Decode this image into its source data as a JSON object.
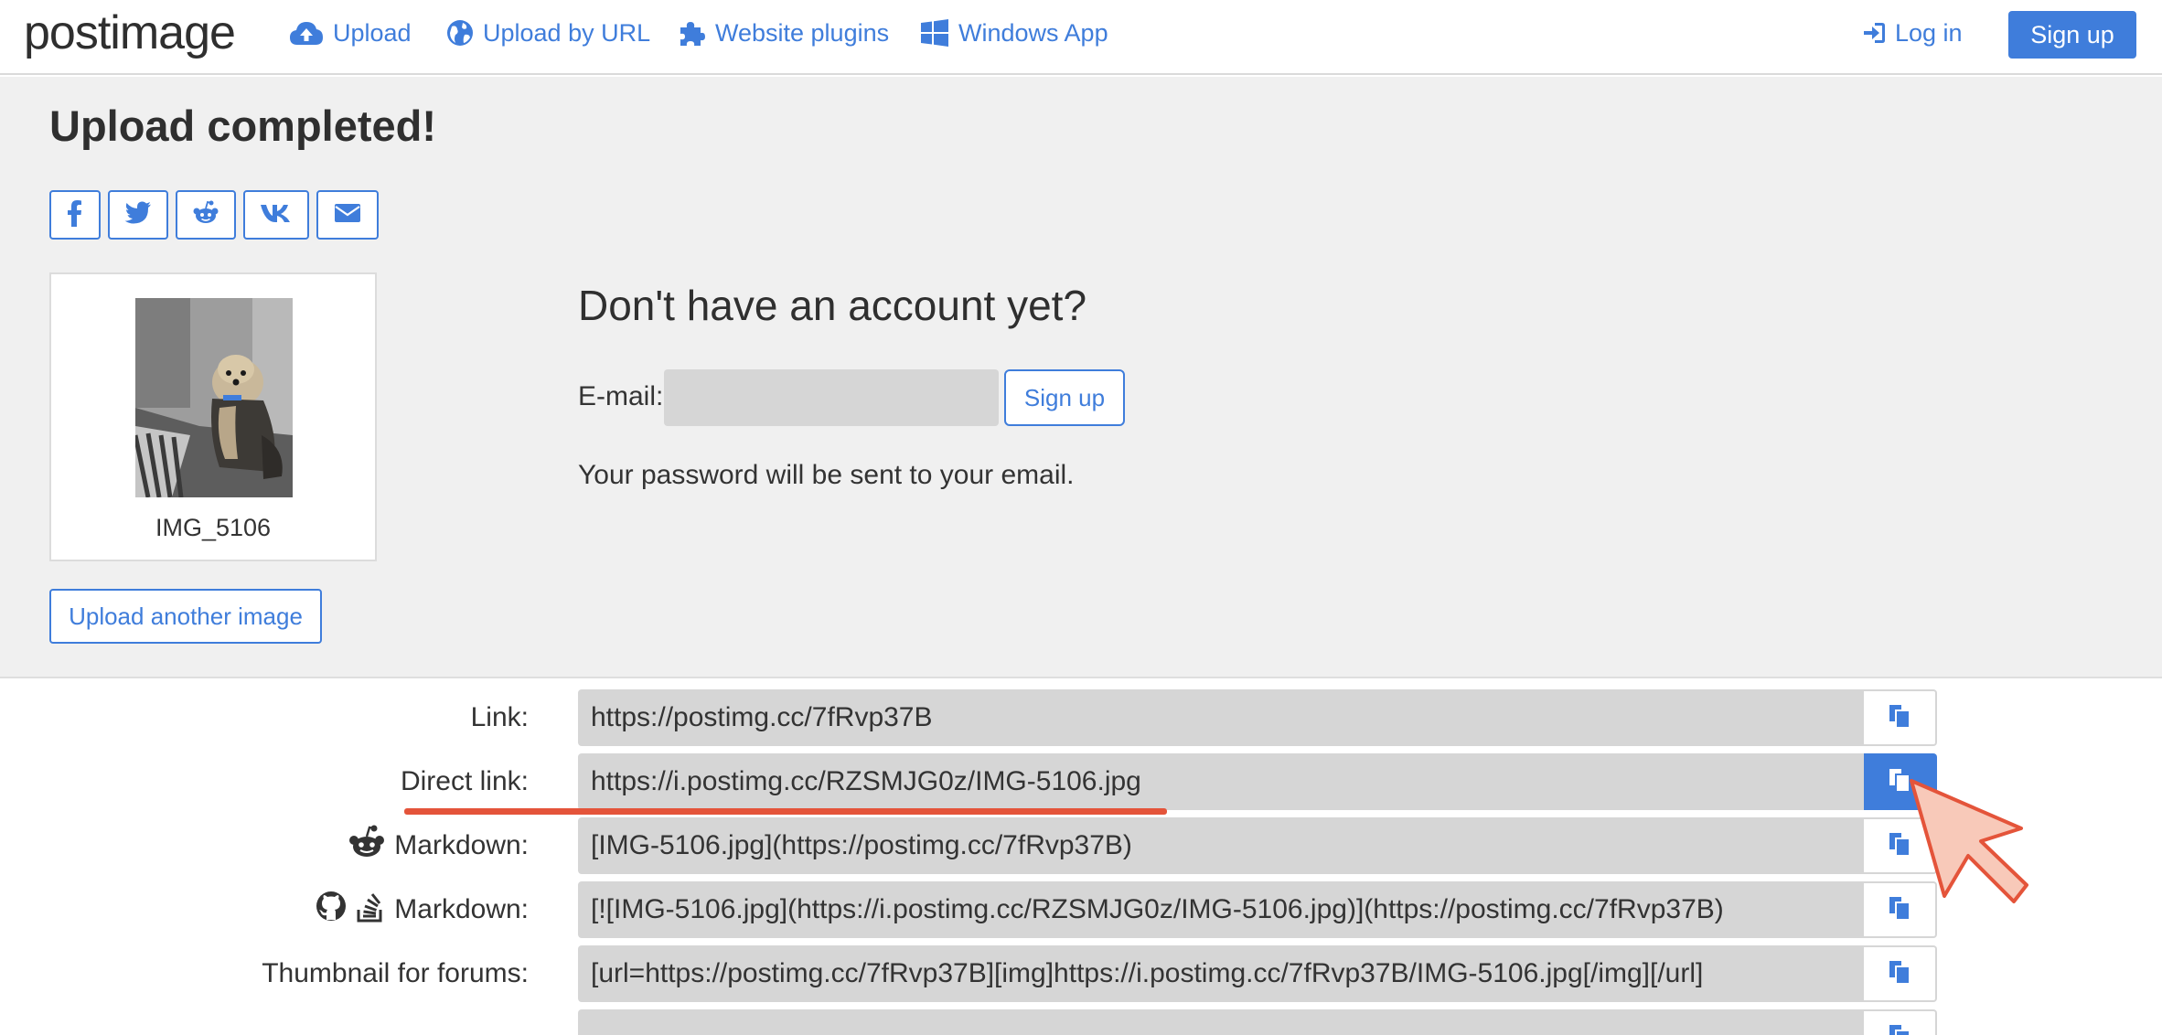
{
  "brand": {
    "logo_text": "postimage"
  },
  "nav": {
    "upload": "Upload",
    "upload_by_url": "Upload by URL",
    "website_plugins": "Website plugins",
    "windows_app": "Windows App",
    "login": "Log in",
    "signup": "Sign up"
  },
  "upload": {
    "title": "Upload completed!",
    "share_icons": [
      "facebook-icon",
      "twitter-icon",
      "reddit-icon",
      "vk-icon",
      "envelope-icon"
    ],
    "image_name": "IMG_5106",
    "upload_another": "Upload another image"
  },
  "account": {
    "heading": "Don't have an account yet?",
    "email_label": "E-mail:",
    "email_value": "",
    "signup_button": "Sign up",
    "note": "Your password will be sent to your email."
  },
  "links": [
    {
      "label": "Link:",
      "value": "https://postimg.cc/7fRvp37B"
    },
    {
      "label": "Direct link:",
      "value": "https://i.postimg.cc/RZSMJG0z/IMG-5106.jpg"
    },
    {
      "label": "Markdown:",
      "value": "[IMG-5106.jpg](https://postimg.cc/7fRvp37B)"
    },
    {
      "label": "Markdown:",
      "value": "[![IMG-5106.jpg](https://i.postimg.cc/RZSMJG0z/IMG-5106.jpg)](https://postimg.cc/7fRvp37B)"
    },
    {
      "label": "Thumbnail for forums:",
      "value": "[url=https://postimg.cc/7fRvp37B][img]https://i.postimg.cc/7fRvp37B/IMG-5106.jpg[/img][/url]"
    },
    {
      "label": "",
      "value": ""
    }
  ],
  "colors": {
    "accent": "#3f7ddb",
    "highlight": "#e4543a",
    "panel_bg": "#f0f0f0",
    "field_bg": "#d6d6d6",
    "pointer_fill": "#f8c9b9"
  }
}
